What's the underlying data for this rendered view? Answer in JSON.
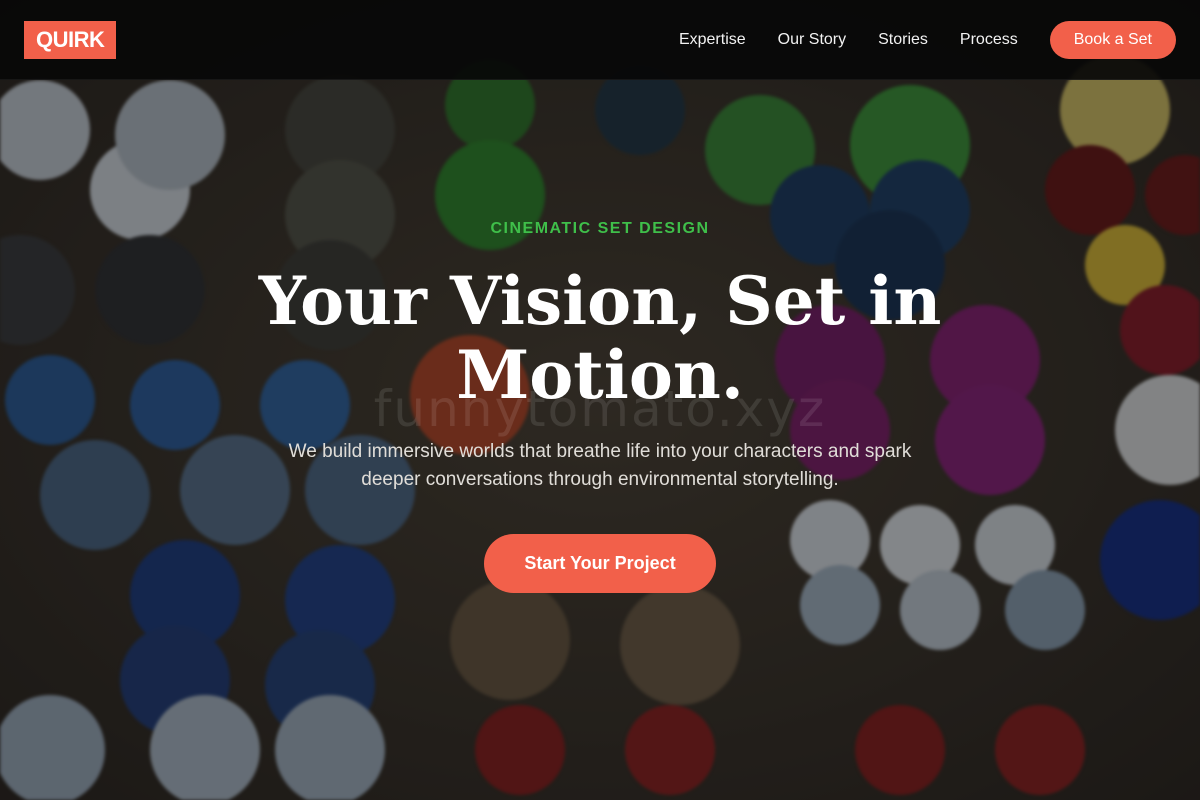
{
  "brand": {
    "logo_text": "QUIRK",
    "accent": "#f2604a",
    "eyebrow_color": "#3fbf4a"
  },
  "nav": {
    "links": [
      "Expertise",
      "Our Story",
      "Stories",
      "Process"
    ],
    "cta_label": "Book a Set"
  },
  "hero": {
    "eyebrow": "CINEMATIC SET DESIGN",
    "headline": "Your Vision, Set in Motion.",
    "subtext": "We build immersive worlds that breathe life into your characters and spark deeper conversations through environmental storytelling.",
    "cta_label": "Start Your Project",
    "watermark": "funnytomato.xyz",
    "background": "buttons-photo"
  }
}
